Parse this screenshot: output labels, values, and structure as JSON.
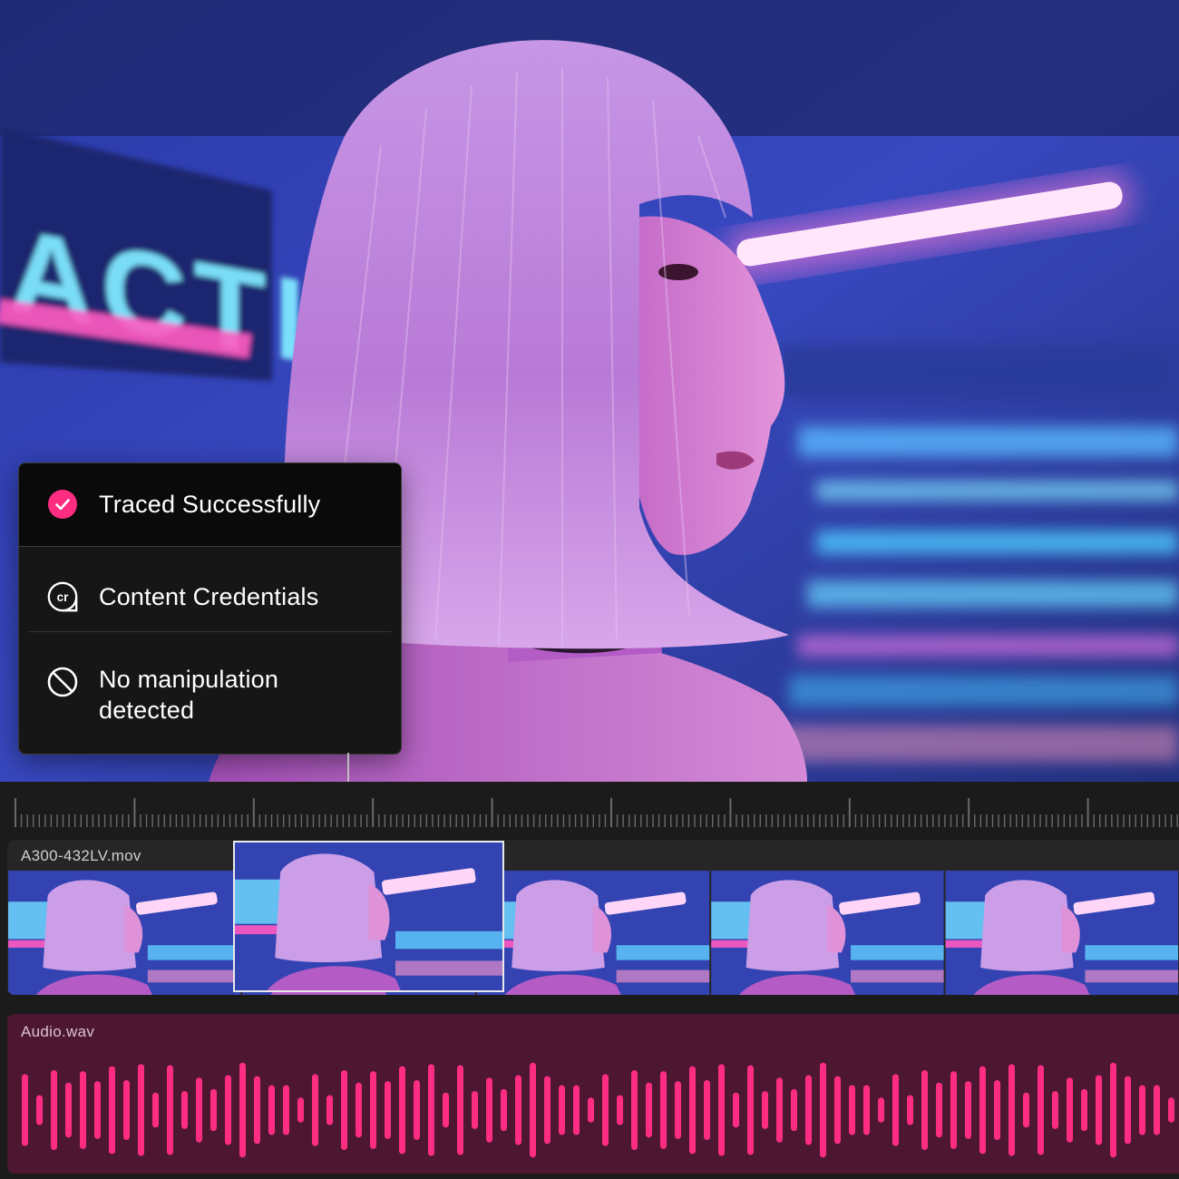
{
  "panel": {
    "traced": {
      "label": "Traced Successfully",
      "icon": "check-circle-icon",
      "color": "#ff2d82"
    },
    "credentials": {
      "label": "Content Credentials",
      "icon": "cr-badge-icon",
      "badge_text": "cr"
    },
    "manipulation": {
      "label": "No manipulation detected",
      "icon": "prohibited-icon"
    }
  },
  "timeline": {
    "video_clip": {
      "filename": "A300-432LV.mov",
      "frame_count": 5,
      "selected_frame": 2
    },
    "audio_clip": {
      "filename": "Audio.wav",
      "waveform_color": "#ff2d82",
      "track_color": "#4d1732"
    }
  },
  "colors": {
    "neon_pink": "#ff4fb3",
    "neon_cyan": "#3fd6ff",
    "scene_blue": "#2c3ba8",
    "panel_bg": "#161616"
  }
}
